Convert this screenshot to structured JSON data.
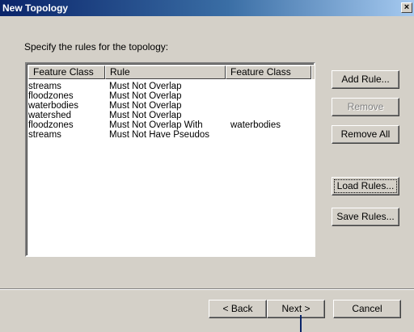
{
  "window": {
    "title": "New Topology",
    "close_glyph": "×"
  },
  "prompt": "Specify the rules for the topology:",
  "rules_table": {
    "columns": [
      "Feature Class",
      "Rule",
      "Feature Class"
    ],
    "rows": [
      [
        "streams",
        "Must Not Overlap",
        ""
      ],
      [
        "floodzones",
        "Must Not Overlap",
        ""
      ],
      [
        "waterbodies",
        "Must Not Overlap",
        ""
      ],
      [
        "watershed",
        "Must Not Overlap",
        ""
      ],
      [
        "floodzones",
        "Must Not Overlap With",
        "waterbodies"
      ],
      [
        "streams",
        "Must Not Have Pseudos",
        ""
      ]
    ]
  },
  "buttons": {
    "add_rule": "Add Rule...",
    "remove": "Remove",
    "remove_all": "Remove All",
    "load_rules": "Load Rules...",
    "save_rules": "Save Rules...",
    "back": "< Back",
    "next": "Next >",
    "cancel": "Cancel"
  }
}
